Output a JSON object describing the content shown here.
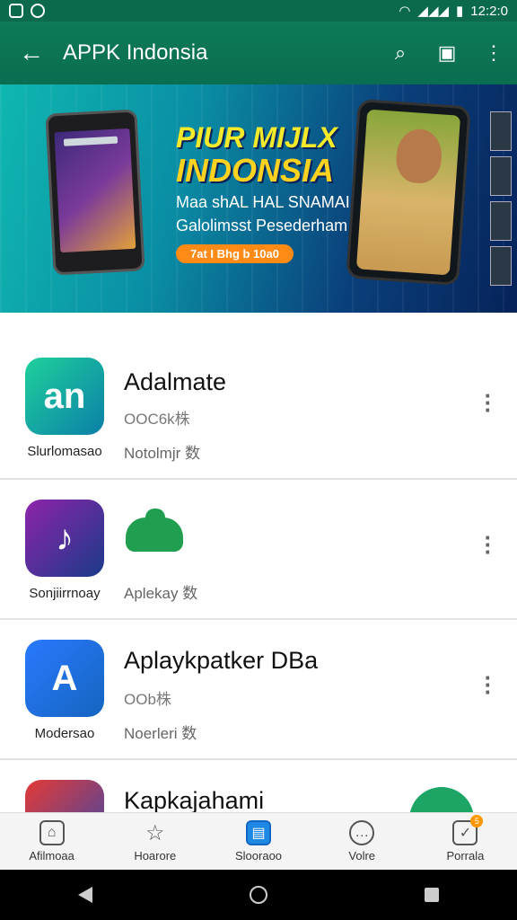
{
  "status_bar": {
    "time": "12:2:0"
  },
  "app_bar": {
    "title": "APPK Indonsia"
  },
  "banner": {
    "line1": "PIUR MIJLX",
    "line2": "INDONSIA",
    "sub1": "Maa shAL HAL SNAMAI",
    "sub2": "Galolimsst Pesederham",
    "pill": "7at I Bhg b 10a0"
  },
  "apps": [
    {
      "icon_text": "an",
      "caption": "Slurlomasao",
      "name": "Adalmate",
      "size": "OOC6k株",
      "meta": "Notolmjr 数",
      "colors": [
        "#18c28f",
        "#0b7fa8"
      ]
    },
    {
      "icon_text": "♪",
      "caption": "Sonjiirrnoay",
      "name": "",
      "size": "",
      "meta": "Aplekay 数",
      "colors": [
        "#7b2ca8",
        "#1a3a8a"
      ]
    },
    {
      "icon_text": "A",
      "caption": "Modersao",
      "name": "Aplaykpatker DBa",
      "size": "OOb株",
      "meta": "Noerleri 数",
      "colors": [
        "#2979ff",
        "#1565c0"
      ]
    },
    {
      "icon_text": "",
      "caption": "",
      "name": "Kapkajahami",
      "size": "",
      "meta": "",
      "colors": [
        "#e53935",
        "#3949ab"
      ]
    }
  ],
  "bottom_nav": [
    {
      "label": "Afilmoaa",
      "icon": "home-icon"
    },
    {
      "label": "Hoarore",
      "icon": "star-icon"
    },
    {
      "label": "Slooraoo",
      "icon": "store-icon"
    },
    {
      "label": "Volre",
      "icon": "chat-icon"
    },
    {
      "label": "Porrala",
      "icon": "profile-icon",
      "badge": "5"
    }
  ]
}
